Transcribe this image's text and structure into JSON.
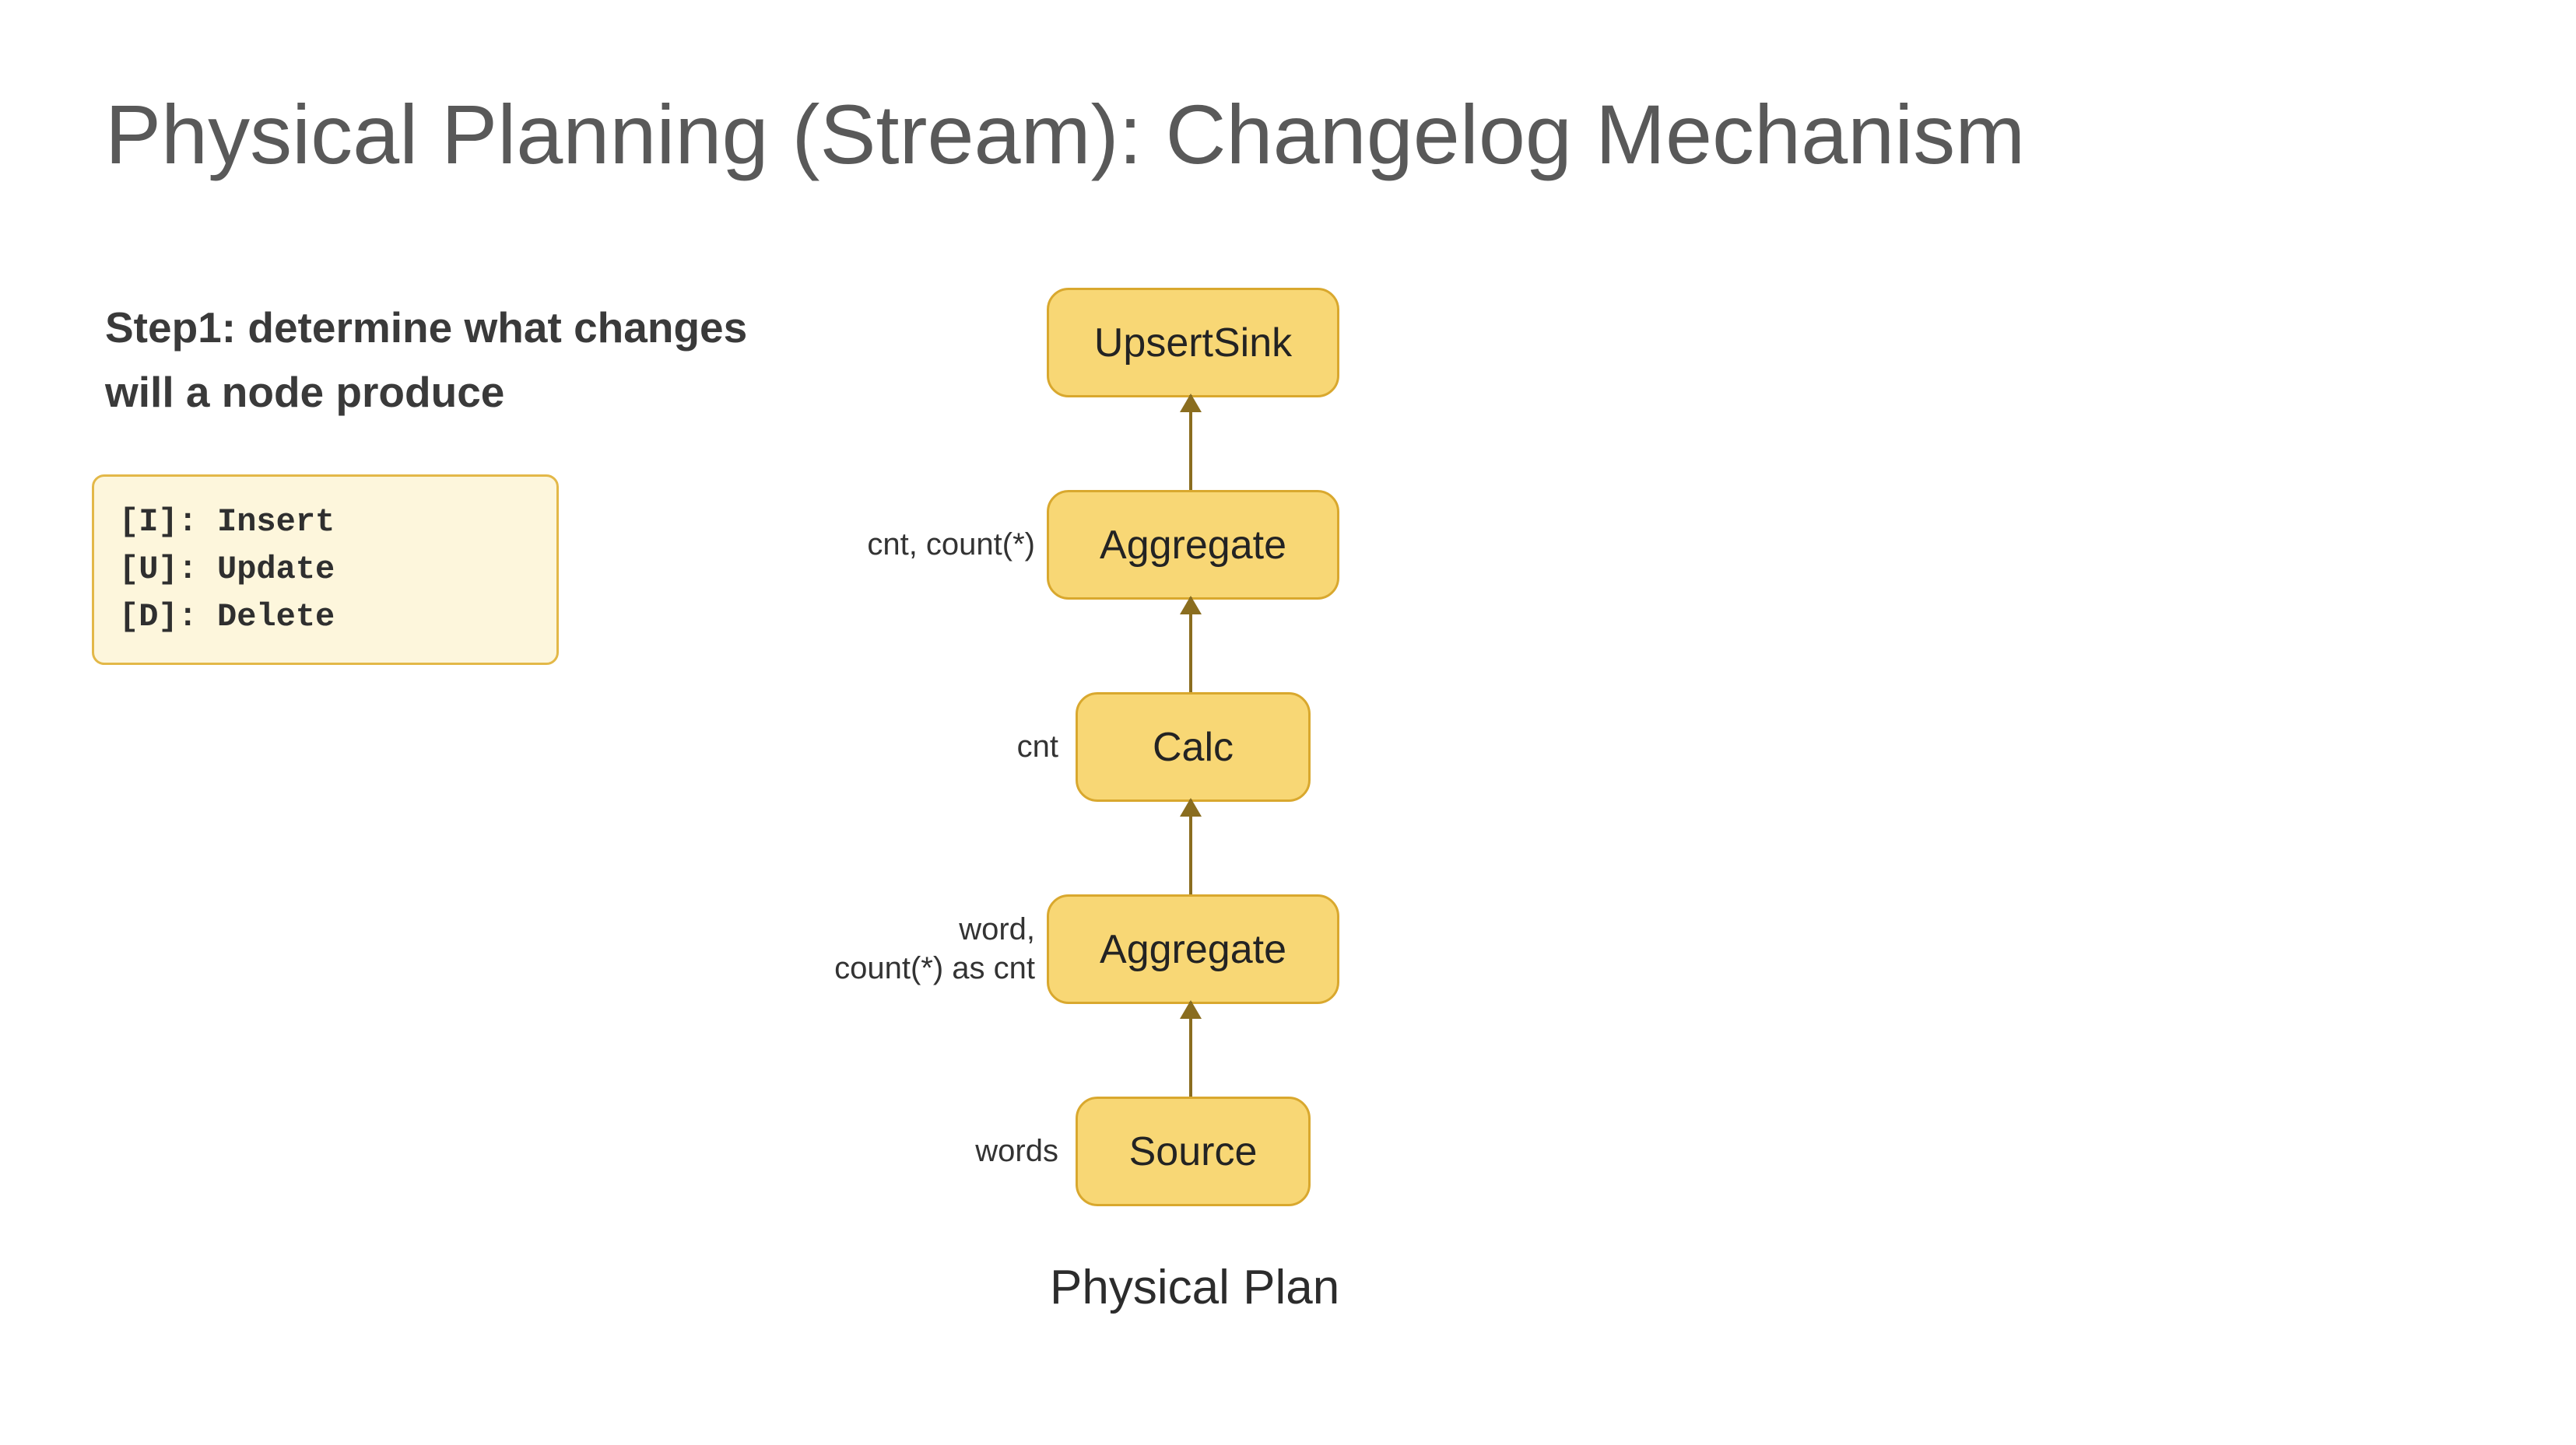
{
  "title": "Physical Planning (Stream): Changelog Mechanism",
  "step": {
    "line1": "Step1: determine what changes",
    "line2": " will a node produce"
  },
  "legend": {
    "insert": "[I]: Insert",
    "update": "[U]: Update",
    "delete": "[D]: Delete"
  },
  "diagram": {
    "caption": "Physical Plan",
    "nodes": {
      "sink": {
        "label": "UpsertSink"
      },
      "aggregate2": {
        "label": "Aggregate",
        "side": "cnt, count(*)"
      },
      "calc": {
        "label": "Calc",
        "side": "cnt"
      },
      "aggregate1": {
        "label": "Aggregate",
        "side": "word,\ncount(*) as cnt"
      },
      "source": {
        "label": "Source",
        "side": "words"
      }
    }
  }
}
